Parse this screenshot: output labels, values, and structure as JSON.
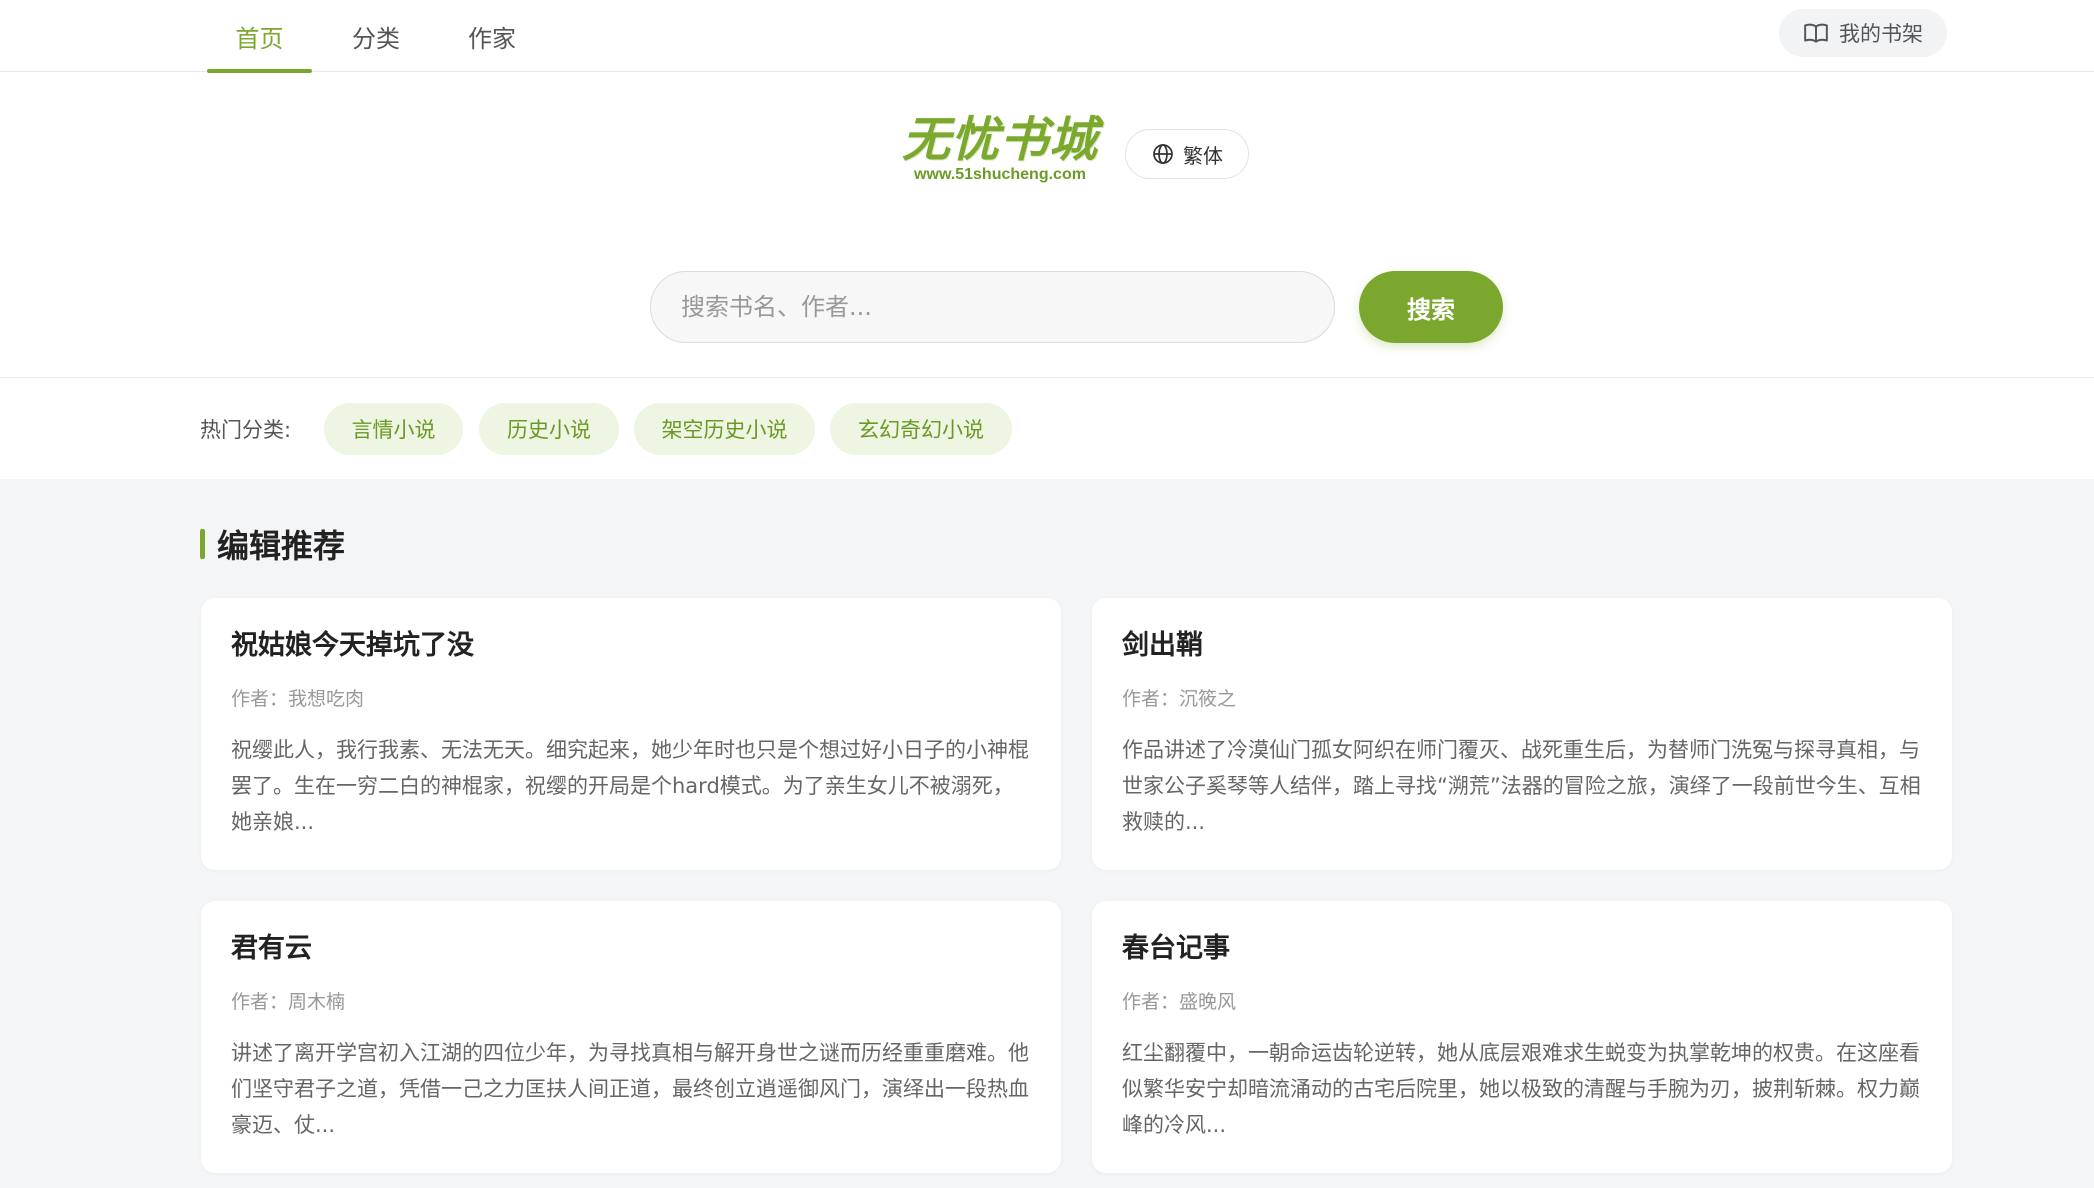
{
  "nav": {
    "tabs": [
      {
        "label": "首页",
        "active": true
      },
      {
        "label": "分类",
        "active": false
      },
      {
        "label": "作家",
        "active": false
      }
    ],
    "shelf_label": "我的书架",
    "shelf_icon": "book-open-icon"
  },
  "logo": {
    "title": "无忧书城",
    "url": "www.51shucheng.com"
  },
  "lang_switch": {
    "label": "繁体",
    "icon": "globe-icon"
  },
  "search": {
    "placeholder": "搜索书名、作者...",
    "value": "",
    "button_label": "搜索"
  },
  "hot_categories": {
    "label": "热门分类:",
    "items": [
      "言情小说",
      "历史小说",
      "架空历史小说",
      "玄幻奇幻小说"
    ]
  },
  "recommend": {
    "title": "编辑推荐",
    "books": [
      {
        "title": "祝姑娘今天掉坑了没",
        "author": "作者：我想吃肉",
        "desc": "祝缨此人，我行我素、无法无天。细究起来，她少年时也只是个想过好小日子的小神棍罢了。生在一穷二白的神棍家，祝缨的开局是个hard模式。为了亲生女儿不被溺死，她亲娘..."
      },
      {
        "title": "剑出鞘",
        "author": "作者：沉筱之",
        "desc": "作品讲述了冷漠仙门孤女阿织在师门覆灭、战死重生后，为替师门洗冤与探寻真相，与世家公子奚琴等人结伴，踏上寻找“溯荒”法器的冒险之旅，演绎了一段前世今生、互相救赎的..."
      },
      {
        "title": "君有云",
        "author": "作者：周木楠",
        "desc": "讲述了离开学宫初入江湖的四位少年，为寻找真相与解开身世之谜而历经重重磨难。他们坚守君子之道，凭借一己之力匡扶人间正道，最终创立逍遥御风门，演绎出一段热血豪迈、仗..."
      },
      {
        "title": "春台记事",
        "author": "作者：盛晚风",
        "desc": "红尘翻覆中，一朝命运齿轮逆转，她从底层艰难求生蜕变为执掌乾坤的权贵。在这座看似繁华安宁却暗流涌动的古宅后院里，她以极致的清醒与手腕为刃，披荆斩棘。权力巅峰的冷风..."
      }
    ]
  },
  "colors": {
    "accent": "#7ba72f",
    "chip_bg": "#eef5e3",
    "page_bg": "#f4f5f7"
  }
}
